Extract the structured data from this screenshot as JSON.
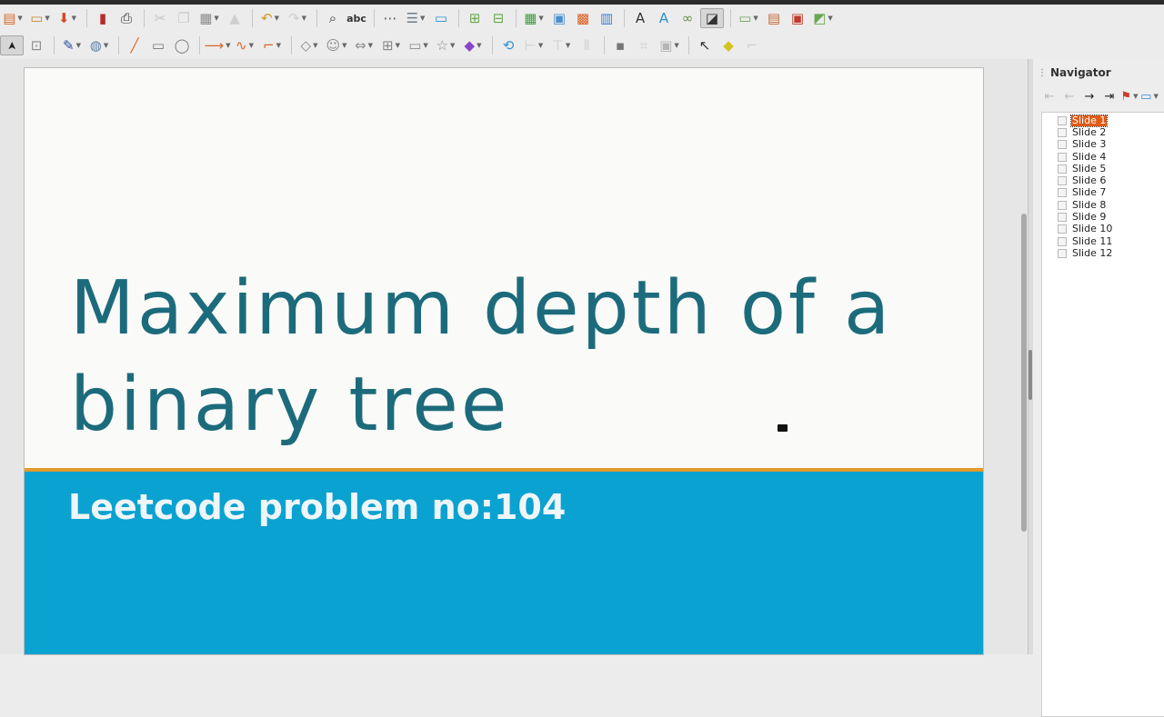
{
  "toolbar1": [
    {
      "name": "new-icon",
      "glyph": "▤",
      "color": "#d9692a",
      "dd": true
    },
    {
      "name": "open-icon",
      "glyph": "▭",
      "color": "#c98a2c",
      "dd": true
    },
    {
      "name": "save-icon",
      "glyph": "⬇",
      "color": "#d34a2a",
      "dd": true
    },
    {
      "sep": true
    },
    {
      "name": "export-pdf-icon",
      "glyph": "▮",
      "color": "#b52b2b"
    },
    {
      "name": "print-icon",
      "glyph": "⎙",
      "color": "#333333"
    },
    {
      "sep": true
    },
    {
      "name": "cut-icon",
      "glyph": "✂",
      "color": "#c6c6c6"
    },
    {
      "name": "copy-icon",
      "glyph": "❐",
      "color": "#cccccc"
    },
    {
      "name": "paste-icon",
      "glyph": "▦",
      "color": "#8a8a8a",
      "dd": true
    },
    {
      "name": "clone-formatting-icon",
      "glyph": "▲",
      "color": "#cfcfcf"
    },
    {
      "sep": true
    },
    {
      "name": "undo-icon",
      "glyph": "↶",
      "color": "#d49a2a",
      "dd": true
    },
    {
      "name": "redo-icon",
      "glyph": "↷",
      "color": "#cfcfcf",
      "dd": true
    },
    {
      "sep": true
    },
    {
      "name": "find-replace-icon",
      "glyph": "⌕",
      "color": "#333333"
    },
    {
      "name": "spelling-icon",
      "glyph": "abc",
      "color": "#333333",
      "small": true
    },
    {
      "sep": true
    },
    {
      "name": "grid-icon",
      "glyph": "⋯",
      "color": "#555555"
    },
    {
      "name": "display-views-icon",
      "glyph": "☰",
      "color": "#6d7d8d",
      "dd": true
    },
    {
      "name": "master-slide-icon",
      "glyph": "▭",
      "color": "#2d8fd0"
    },
    {
      "sep": true
    },
    {
      "name": "new-slide-icon",
      "glyph": "⊞",
      "color": "#6aa84f"
    },
    {
      "name": "duplicate-slide-icon",
      "glyph": "⊟",
      "color": "#6aa84f"
    },
    {
      "sep": true
    },
    {
      "name": "table-icon",
      "glyph": "▦",
      "color": "#3d9d3d",
      "dd": true
    },
    {
      "name": "image-icon",
      "glyph": "▣",
      "color": "#4a8fcf"
    },
    {
      "name": "media-icon",
      "glyph": "▩",
      "color": "#e05a17"
    },
    {
      "name": "chart-icon",
      "glyph": "▥",
      "color": "#3b7dd8"
    },
    {
      "sep": true
    },
    {
      "name": "text-box-icon",
      "glyph": "A",
      "color": "#333333"
    },
    {
      "name": "fontwork-icon",
      "glyph": "A",
      "color": "#2d8fd0"
    },
    {
      "name": "hyperlink-icon",
      "glyph": "∞",
      "color": "#6a8f4a"
    },
    {
      "name": "draw-functions-icon",
      "glyph": "◪",
      "color": "#333333",
      "selected": true
    },
    {
      "sep": true
    },
    {
      "name": "start-slideshow-icon",
      "glyph": "▭",
      "color": "#6aa84f",
      "dd": true
    },
    {
      "name": "slide-layout-icon",
      "glyph": "▤",
      "color": "#c46a3a"
    },
    {
      "name": "delete-slide-icon",
      "glyph": "▣",
      "color": "#c0392b"
    },
    {
      "name": "slide-transition-icon",
      "glyph": "◩",
      "color": "#6aa84f",
      "dd": true
    }
  ],
  "toolbar2": [
    {
      "name": "select-icon",
      "glyph": "➤",
      "color": "#222222",
      "selected": true,
      "rotate": true
    },
    {
      "name": "zoom-pan-icon",
      "glyph": "⊡",
      "color": "#8a8a8a"
    },
    {
      "sep": true
    },
    {
      "name": "line-color-icon",
      "glyph": "✎",
      "color": "#2a4fa0",
      "dd": true
    },
    {
      "name": "fill-color-icon",
      "glyph": "◍",
      "color": "#5a7fa0",
      "dd": true
    },
    {
      "sep": true
    },
    {
      "name": "line-icon",
      "glyph": "╱",
      "color": "#d9692a"
    },
    {
      "name": "rectangle-icon",
      "glyph": "▭",
      "color": "#777777"
    },
    {
      "name": "ellipse-icon",
      "glyph": "◯",
      "color": "#777777"
    },
    {
      "sep": true
    },
    {
      "name": "line-arrow-icon",
      "glyph": "⟶",
      "color": "#d9692a",
      "dd": true
    },
    {
      "name": "curve-icon",
      "glyph": "∿",
      "color": "#d9692a",
      "dd": true
    },
    {
      "name": "connector-icon",
      "glyph": "⌐",
      "color": "#d9692a",
      "dd": true
    },
    {
      "sep": true
    },
    {
      "name": "basic-shapes-icon",
      "glyph": "◇",
      "color": "#888888",
      "dd": true
    },
    {
      "name": "symbol-shapes-icon",
      "glyph": "☺",
      "color": "#888888",
      "dd": true
    },
    {
      "name": "block-arrows-icon",
      "glyph": "⇔",
      "color": "#888888",
      "dd": true
    },
    {
      "name": "flowchart-icon",
      "glyph": "⊞",
      "color": "#888888",
      "dd": true
    },
    {
      "name": "callouts-icon",
      "glyph": "▭",
      "color": "#888888",
      "dd": true
    },
    {
      "name": "stars-icon",
      "glyph": "☆",
      "color": "#888888",
      "dd": true
    },
    {
      "name": "3d-objects-icon",
      "glyph": "◆",
      "color": "#8b44c8",
      "dd": true
    },
    {
      "sep": true
    },
    {
      "name": "rotate-icon",
      "glyph": "⟲",
      "color": "#2d8fd0"
    },
    {
      "name": "align-icon",
      "glyph": "⊢",
      "color": "#cfcfcf",
      "dd": true
    },
    {
      "name": "arrange-icon",
      "glyph": "⊤",
      "color": "#cfcfcf",
      "dd": true
    },
    {
      "name": "distribute-icon",
      "glyph": "⦀",
      "color": "#cfcfcf"
    },
    {
      "sep": true
    },
    {
      "name": "shadow-icon",
      "glyph": "▪",
      "color": "#777777"
    },
    {
      "name": "crop-icon",
      "glyph": "⌗",
      "color": "#cfcfcf"
    },
    {
      "name": "filter-icon",
      "glyph": "▣",
      "color": "#b5b5b5",
      "dd": true
    },
    {
      "sep": true
    },
    {
      "name": "show-gluepoints-icon",
      "glyph": "↖",
      "color": "#333333"
    },
    {
      "name": "toggle-extrusion-icon",
      "glyph": "◆",
      "color": "#d4c21f"
    },
    {
      "name": "interaction-icon",
      "glyph": "⌐",
      "color": "#cfcfcf"
    }
  ],
  "slide": {
    "title": "Maximum depth of a binary tree",
    "subtitle": "Leetcode problem no:104"
  },
  "navigator": {
    "title": "Navigator",
    "tools": [
      {
        "name": "first-slide-icon",
        "glyph": "⇤",
        "color": "#bcbcbc"
      },
      {
        "name": "previous-slide-icon",
        "glyph": "←",
        "color": "#bcbcbc"
      },
      {
        "name": "next-slide-icon",
        "glyph": "→",
        "color": "#222222"
      },
      {
        "name": "last-slide-icon",
        "glyph": "⇥",
        "color": "#222222"
      },
      {
        "name": "drag-mode-icon",
        "glyph": "⚑",
        "color": "#d33a2a",
        "dd": true
      },
      {
        "name": "show-shapes-icon",
        "glyph": "▭",
        "color": "#2d8fd0",
        "dd": true
      }
    ],
    "items": [
      {
        "label": "Slide 1",
        "active": true
      },
      {
        "label": "Slide 2"
      },
      {
        "label": "Slide 3"
      },
      {
        "label": "Slide 4"
      },
      {
        "label": "Slide 5"
      },
      {
        "label": "Slide 6"
      },
      {
        "label": "Slide 7"
      },
      {
        "label": "Slide 8"
      },
      {
        "label": "Slide 9"
      },
      {
        "label": "Slide 10"
      },
      {
        "label": "Slide 11"
      },
      {
        "label": "Slide 12"
      }
    ]
  }
}
